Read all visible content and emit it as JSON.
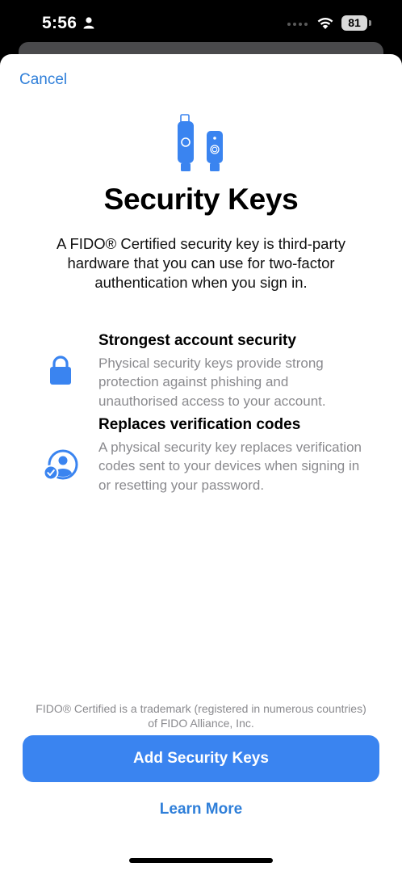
{
  "status_bar": {
    "time": "5:56",
    "battery": "81"
  },
  "header": {
    "cancel_label": "Cancel"
  },
  "main": {
    "title": "Security Keys",
    "intro": "A FIDO® Certified security key is third-party hardware that you can use for two-factor authentication when you sign in.",
    "features": [
      {
        "icon": "lock-icon",
        "title": "Strongest account security",
        "description": "Physical security keys provide strong protection against phishing and unauthorised access to your account."
      },
      {
        "icon": "person-checkmark-icon",
        "title": "Replaces verification codes",
        "description": "A physical security key replaces verification codes sent to your devices when signing in or resetting your password."
      }
    ],
    "footnote": "FIDO® Certified is a trademark (registered in numerous countries) of FIDO Alliance, Inc."
  },
  "actions": {
    "primary_label": "Add Security Keys",
    "secondary_label": "Learn More"
  },
  "colors": {
    "accent": "#3a84f0",
    "link": "#2f7fd9",
    "secondary_text": "#8a8a8e"
  }
}
